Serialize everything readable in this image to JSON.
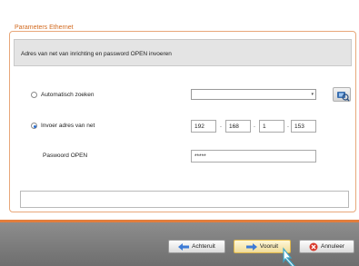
{
  "panel": {
    "title": "Parameters Ethernet",
    "info": "Adres van net van inrichting en password OPEN invoeren"
  },
  "auto_search": {
    "label": "Automatisch zoeken",
    "selected": false,
    "dropdown_value": ""
  },
  "manual": {
    "label": "Invoer adres van net",
    "selected": true,
    "ip": [
      "192",
      "168",
      "1",
      "153"
    ]
  },
  "password": {
    "label": "Paswoord OPEN",
    "value": "*****"
  },
  "footer": {
    "back_label": "Achteruit",
    "next_label": "Vooruit",
    "cancel_label": "Annuleer"
  },
  "colors": {
    "accent": "#e27d3c",
    "footer_bg": "#7d7d7d"
  }
}
